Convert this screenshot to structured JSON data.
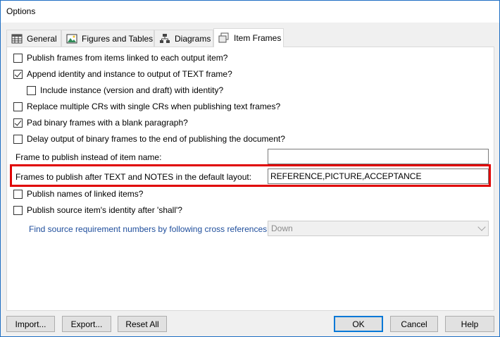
{
  "window": {
    "title": "Options"
  },
  "tabs": [
    {
      "label": "General",
      "icon": "grid-icon"
    },
    {
      "label": "Figures and Tables",
      "icon": "picture-icon"
    },
    {
      "label": "Diagrams",
      "icon": "diagram-icon"
    },
    {
      "label": "Item Frames",
      "icon": "frames-icon",
      "active": true
    }
  ],
  "options": {
    "publish_frames_linked": {
      "label": "Publish frames from items linked to each output item?",
      "checked": false
    },
    "append_identity": {
      "label": "Append identity and instance to output of TEXT frame?",
      "checked": true
    },
    "include_instance": {
      "label": "Include instance (version and draft) with identity?",
      "checked": false
    },
    "replace_crs": {
      "label": "Replace multiple CRs with single CRs when publishing text frames?",
      "checked": false
    },
    "pad_binary": {
      "label": "Pad binary frames with a blank paragraph?",
      "checked": true
    },
    "delay_binary": {
      "label": "Delay output of binary frames to the end of publishing the document?",
      "checked": false
    },
    "publish_names_linked": {
      "label": "Publish names of linked items?",
      "checked": false
    },
    "publish_source_identity": {
      "label": "Publish source item's identity after 'shall'?",
      "checked": false
    }
  },
  "fields": {
    "frame_instead_label": "Frame to publish instead of item name:",
    "frame_instead_value": "",
    "frames_after_label": "Frames to publish after TEXT and NOTES in the default layout:",
    "frames_after_value": "REFERENCE,PICTURE,ACCEPTANCE",
    "find_source_label": "Find source requirement numbers by following cross references:",
    "find_source_value": "Down"
  },
  "buttons": {
    "import": "Import...",
    "export": "Export...",
    "reset": "Reset All",
    "ok": "OK",
    "cancel": "Cancel",
    "help": "Help"
  },
  "colors": {
    "highlight": "#e00000",
    "link_label": "#1f4e9c",
    "default_button_border": "#0078d7"
  }
}
